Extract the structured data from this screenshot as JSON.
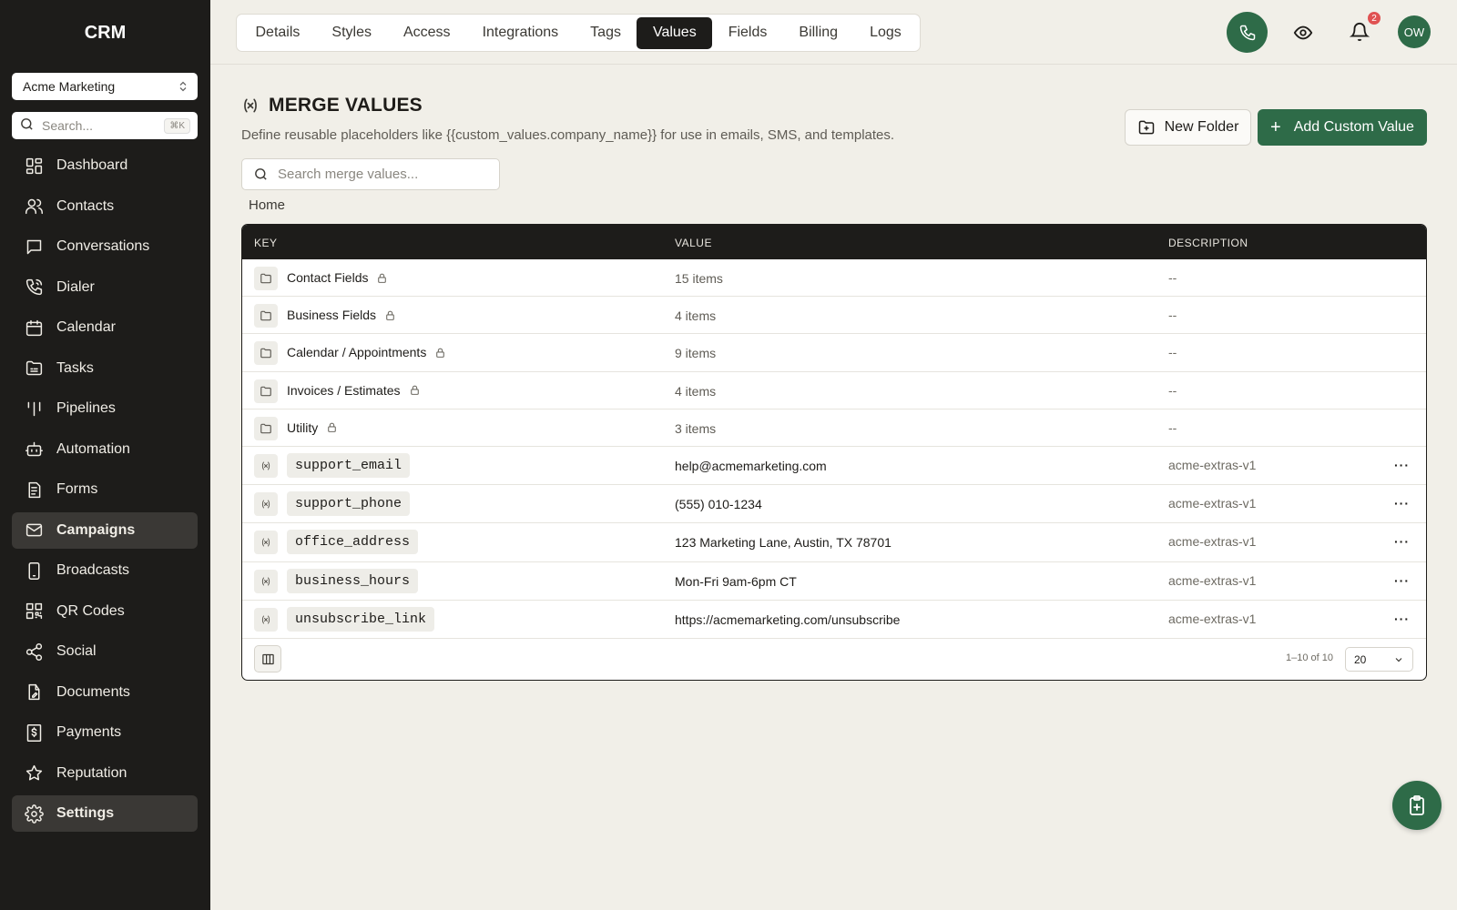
{
  "sidebar": {
    "brand": "CRM",
    "account": "Acme Marketing",
    "search_placeholder": "Search...",
    "search_shortcut": "⌘K",
    "items": [
      {
        "label": "Dashboard",
        "icon": "dashboard-icon"
      },
      {
        "label": "Contacts",
        "icon": "contacts-icon"
      },
      {
        "label": "Conversations",
        "icon": "chat-icon"
      },
      {
        "label": "Dialer",
        "icon": "phone-icon"
      },
      {
        "label": "Calendar",
        "icon": "calendar-icon"
      },
      {
        "label": "Tasks",
        "icon": "tasks-icon"
      },
      {
        "label": "Pipelines",
        "icon": "pipelines-icon"
      },
      {
        "label": "Automation",
        "icon": "robot-icon"
      },
      {
        "label": "Forms",
        "icon": "forms-icon"
      },
      {
        "label": "Campaigns",
        "icon": "mail-icon"
      },
      {
        "label": "Broadcasts",
        "icon": "mobile-icon"
      },
      {
        "label": "QR Codes",
        "icon": "qr-code-icon"
      },
      {
        "label": "Social",
        "icon": "share-icon"
      },
      {
        "label": "Documents",
        "icon": "document-edit-icon"
      },
      {
        "label": "Payments",
        "icon": "payments-icon"
      },
      {
        "label": "Reputation",
        "icon": "star-icon"
      },
      {
        "label": "Settings",
        "icon": "gear-icon"
      }
    ]
  },
  "tabs": [
    "Details",
    "Styles",
    "Access",
    "Integrations",
    "Tags",
    "Values",
    "Fields",
    "Billing",
    "Logs"
  ],
  "active_tab": "Values",
  "header": {
    "notification_count": "2",
    "avatar_initials": "OW"
  },
  "page": {
    "title": "MERGE VALUES",
    "subtitle": "Define reusable placeholders like {{custom_values.company_name}} for use in emails, SMS, and templates.",
    "new_folder_label": "New Folder",
    "add_label": "Add Custom Value",
    "search_placeholder": "Search merge values...",
    "breadcrumb": "Home"
  },
  "table": {
    "columns": [
      "KEY",
      "VALUE",
      "DESCRIPTION"
    ],
    "folders": [
      {
        "name": "Contact Fields",
        "value": "15 items",
        "description": "--"
      },
      {
        "name": "Business Fields",
        "value": "4 items",
        "description": "--"
      },
      {
        "name": "Calendar / Appointments",
        "value": "9 items",
        "description": "--"
      },
      {
        "name": "Invoices / Estimates",
        "value": "4 items",
        "description": "--"
      },
      {
        "name": "Utility",
        "value": "3 items",
        "description": "--"
      }
    ],
    "values": [
      {
        "key": "support_email",
        "value": "help@acmemarketing.com",
        "description": "acme-extras-v1"
      },
      {
        "key": "support_phone",
        "value": "(555) 010-1234",
        "description": "acme-extras-v1"
      },
      {
        "key": "office_address",
        "value": "123 Marketing Lane, Austin, TX 78701",
        "description": "acme-extras-v1"
      },
      {
        "key": "business_hours",
        "value": "Mon-Fri 9am-6pm CT",
        "description": "acme-extras-v1"
      },
      {
        "key": "unsubscribe_link",
        "value": "https://acmemarketing.com/unsubscribe",
        "description": "acme-extras-v1"
      }
    ],
    "more_label": "···",
    "pagination_text": "1–10 of 10",
    "page_size": "20"
  },
  "colors": {
    "sidebar_bg": "#1d1c1a",
    "accent": "#2e6b48",
    "page_bg": "#f1efe8",
    "badge": "#e05252"
  }
}
